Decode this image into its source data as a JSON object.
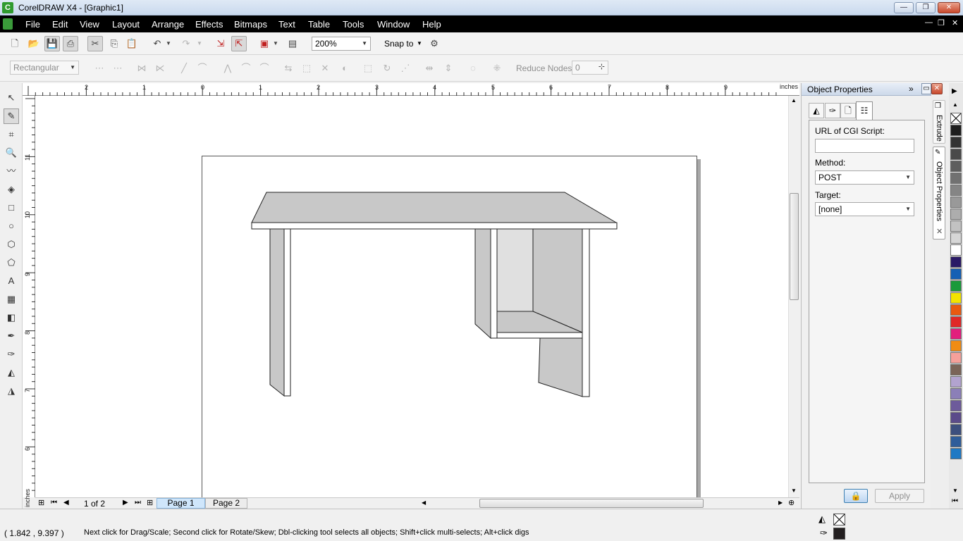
{
  "title_bar": {
    "logo_letter": "C",
    "title": "CorelDRAW X4 - [Graphic1]"
  },
  "menu": [
    "File",
    "Edit",
    "View",
    "Layout",
    "Arrange",
    "Effects",
    "Bitmaps",
    "Text",
    "Table",
    "Tools",
    "Window",
    "Help"
  ],
  "standard_toolbar": {
    "zoom_value": "200%",
    "snap_label": "Snap to"
  },
  "property_bar": {
    "shape_mode": "Rectangular",
    "reduce_nodes_label": "Reduce Nodes",
    "reduce_nodes_value": "0"
  },
  "ruler": {
    "unit": "inches",
    "h_labels": [
      "2",
      "1",
      "0",
      "1",
      "2",
      "3",
      "4",
      "5",
      "6",
      "7",
      "8",
      "9"
    ],
    "v_labels": [
      "11",
      "10",
      "9",
      "8",
      "7",
      "6"
    ]
  },
  "page_nav": {
    "page_count": "1 of 2",
    "tabs": [
      "Page 1",
      "Page 2"
    ],
    "active_tab": 0
  },
  "docker": {
    "title": "Object Properties",
    "url_label": "URL of CGI Script:",
    "url_value": "",
    "method_label": "Method:",
    "method_value": "POST",
    "target_label": "Target:",
    "target_value": "[none]",
    "apply_label": "Apply",
    "side_tabs": [
      "Extrude",
      "Object Properties"
    ]
  },
  "status": {
    "coords": "( 1.842 , 9.397 )",
    "hint": "Next click for Drag/Scale; Second click for Rotate/Skew; Dbl-clicking tool selects all objects; Shift+click multi-selects; Alt+click digs"
  },
  "fill_color": "#231f20",
  "outline_color": "#231f20",
  "desk_fill": "#c8c8c8",
  "palette_colors": [
    "#1e1e1e",
    "#333333",
    "#4a4a4a",
    "#5e5e5e",
    "#717171",
    "#858585",
    "#999999",
    "#adadad",
    "#c2c2c2",
    "#d6d6d6",
    "#ffffff",
    "#2a1a66",
    "#1560b4",
    "#1a9a3a",
    "#f2e400",
    "#e95a10",
    "#e02828",
    "#e21f7d",
    "#f08c14",
    "#f5a09a",
    "#7a6458",
    "#b2a3cf",
    "#8b7fb8",
    "#6d5b9b",
    "#5b4b8a",
    "#3c4f7e",
    "#2f5d9a",
    "#1f79c4"
  ]
}
